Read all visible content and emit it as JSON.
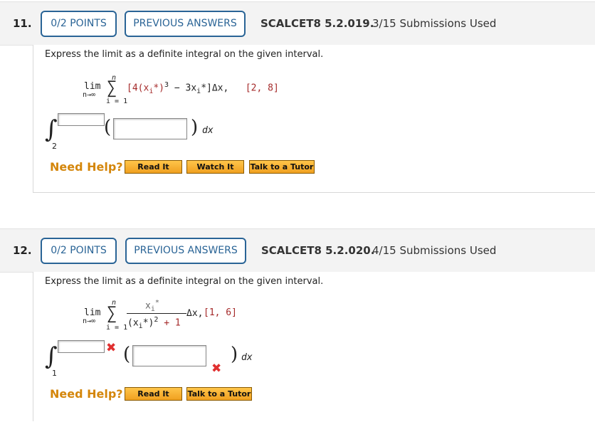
{
  "q11": {
    "number": "11.",
    "points": "0/2 POINTS",
    "previous_answers": "PREVIOUS ANSWERS",
    "code": "SCALCET8 5.2.019.",
    "submissions": "3/15 Submissions Used",
    "prompt": "Express the limit as a definite integral on the given interval.",
    "lim": "lim",
    "n_to_inf": "n→∞",
    "sum_upper": "n",
    "sum_lower": "i = 1",
    "sigma": "∑",
    "term_prefix": "[4(x",
    "term_sub1": "i",
    "term_mid": "*)",
    "term_exp": "3",
    "term_minus": "− 3x",
    "term_sub2": "i",
    "term_star": "*",
    "term_end": "]Δx,",
    "interval": "[2, 8]",
    "lower_limit": "2",
    "upper_limit_value": "",
    "integrand_value": "",
    "dx": "dx",
    "help_label": "Need Help?",
    "buttons": [
      "Read It",
      "Watch It",
      "Talk to a Tutor"
    ]
  },
  "q12": {
    "number": "12.",
    "points": "0/2 POINTS",
    "previous_answers": "PREVIOUS ANSWERS",
    "code": "SCALCET8 5.2.020.",
    "submissions": "4/15 Submissions Used",
    "prompt": "Express the limit as a definite integral on the given interval.",
    "lim": "lim",
    "n_to_inf": "n→∞",
    "sum_upper": "n",
    "sum_lower": "i = 1",
    "sigma": "∑",
    "num_x": "x",
    "num_sub": "i",
    "num_star": "*",
    "den_prefix": "(x",
    "den_sub": "i",
    "den_mid": "*)",
    "den_exp": "2",
    "den_end": " + 1",
    "delta": "Δx,",
    "interval": "[1, 6]",
    "lower_limit": "1",
    "upper_limit_value": "",
    "integrand_value": "",
    "dx": "dx",
    "help_label": "Need Help?",
    "buttons": [
      "Read It",
      "Talk to a Tutor"
    ]
  },
  "colors": {
    "accent": "#2a6496",
    "help": "#d4860b",
    "incorrect": "#e03030",
    "button": "#f0a020"
  }
}
